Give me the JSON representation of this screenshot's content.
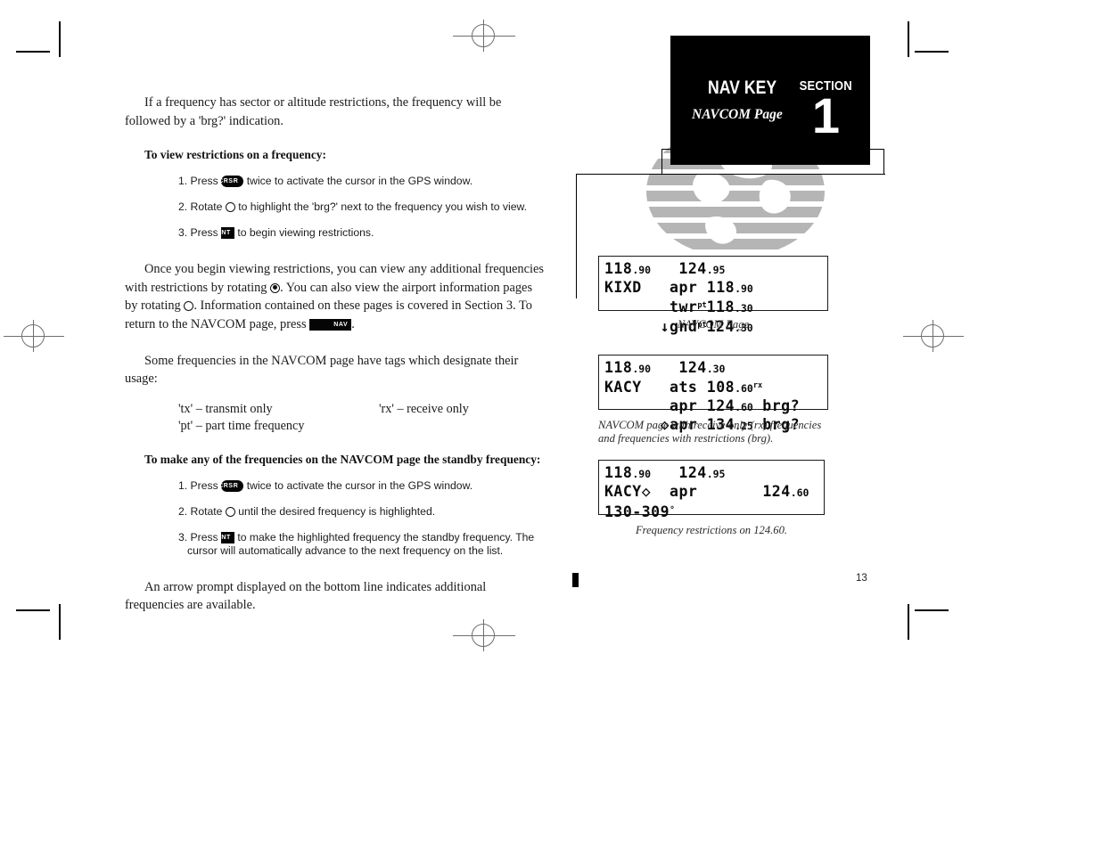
{
  "header": {
    "nav_key": "NAV KEY",
    "page_subtitle": "NAVCOM Page",
    "section_label": "SECTION",
    "section_number": "1"
  },
  "body": {
    "intro": "If a frequency has sector or altitude restrictions, the frequency will be followed by a 'brg?' indication.",
    "heading_view": "To view restrictions on a frequency:",
    "view_steps": [
      {
        "num": "1. Press",
        "key": "CRSR",
        "key_shape": "round",
        "rest": "twice to activate the cursor in the GPS window."
      },
      {
        "num": "2. Rotate",
        "knob": "small-knob",
        "rest": "to highlight the 'brg?' next to the frequency you wish to view."
      },
      {
        "num": "3. Press",
        "key": "ENT",
        "key_shape": "square",
        "rest": "to begin viewing restrictions."
      }
    ],
    "para_once_a": "Once you begin viewing restrictions, you can view any additional frequencies with restrictions by rotating",
    "para_once_b": ". You can also view the airport information pages by rotating",
    "para_once_c": ". Information contained on these pages is covered in Section 3. To return to the NAVCOM page, press",
    "para_once_d": ".",
    "nav_key_inline": "NAV",
    "para_tags_intro": "Some frequencies in the NAVCOM page have tags which designate their usage:",
    "tags": [
      {
        "left": "'tx' – transmit only",
        "right": "'rx' – receive only"
      },
      {
        "left": "'pt' – part time frequency",
        "right": ""
      }
    ],
    "heading_standby": "To make any of the frequencies on the NAVCOM page the standby frequency:",
    "standby_steps": [
      {
        "num": "1. Press",
        "key": "CRSR",
        "key_shape": "round",
        "rest": "twice to activate the cursor in the GPS window."
      },
      {
        "num": "2. Rotate",
        "knob": "small-knob",
        "rest": "until the desired frequency is highlighted."
      },
      {
        "num": "3. Press",
        "key": "ENT",
        "key_shape": "square",
        "rest": "to make the highlighted frequency the standby frequency. The cursor will automatically advance to the next frequency on the list."
      }
    ],
    "para_arrow": "An arrow prompt displayed on the bottom line indicates additional frequencies are available."
  },
  "screens": [
    {
      "id": "navcom-page",
      "lines": [
        "118.90   124.95",
        "KIXD   apr 118.90",
        "       twr pt 118.30",
        "      ↓gnd pt 124.30"
      ],
      "caption": "NAVCOM Page"
    },
    {
      "id": "navcom-rx-brg",
      "lines": [
        "118.90   124.30",
        "KACY   ats 108.60 rx",
        "       apr 124.60 brg?",
        "      ◇apr 134.25 brg?"
      ],
      "caption": "NAVCOM page with receive only (rx) frequencies and frequencies with restrictions (brg)."
    },
    {
      "id": "frequency-restrictions",
      "lines": [
        "118.90   124.95",
        "KACY◇  apr       124.60",
        "130-309°",
        ""
      ],
      "caption": "Frequency restrictions on 124.60."
    }
  ],
  "footer": {
    "page_number": "13"
  },
  "colors": {
    "banner_bg": "#000000",
    "banner_text": "#ffffff",
    "body_text": "#1b1b1b",
    "globe_gray": "#b5b5b5",
    "reg_mark": "#6e6e6e"
  }
}
